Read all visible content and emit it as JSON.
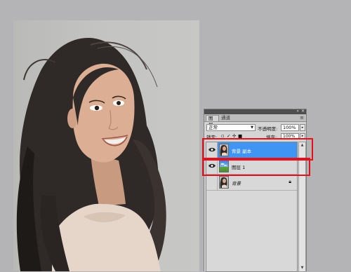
{
  "panel": {
    "tabs": [
      {
        "label": "图层"
      },
      {
        "label": "通道"
      }
    ],
    "collapse_icon": "double-chevron-right-icon",
    "close_icon": "close-icon",
    "menu_icon": "panel-menu-icon",
    "blend_mode": "正常",
    "opacity_label": "不透明度:",
    "opacity_value": "100%",
    "lock_label": "锁定:",
    "fill_label": "填充:",
    "fill_value": "100%",
    "layers": [
      {
        "name": "背景 副本",
        "visible": true,
        "selected": true
      },
      {
        "name": "图层 1",
        "visible": true,
        "selected": false
      },
      {
        "name": "背景",
        "visible": false,
        "selected": false,
        "locked": true
      }
    ]
  },
  "colors": {
    "selection": "#3f95f1",
    "highlight": "#e6101c",
    "workspace": "#b4b3b6"
  }
}
